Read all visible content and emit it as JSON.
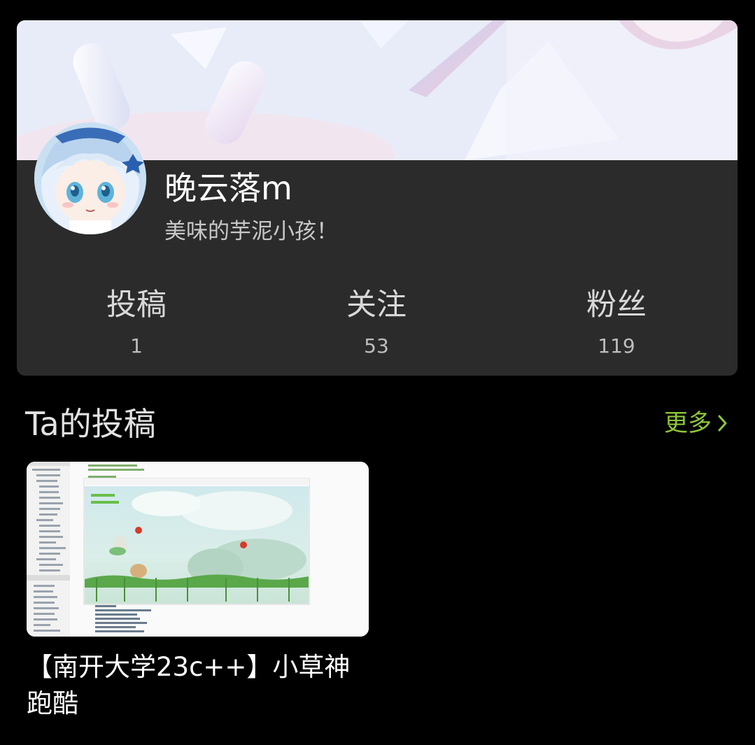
{
  "profile": {
    "username": "晚云落m",
    "bio": "美味的芋泥小孩！",
    "stats": [
      {
        "label": "投稿",
        "value": "1"
      },
      {
        "label": "关注",
        "value": "53"
      },
      {
        "label": "粉丝",
        "value": "119"
      }
    ]
  },
  "section": {
    "title": "Ta的投稿",
    "more_label": "更多"
  },
  "videos": [
    {
      "title": "【南开大学23c++】小草神跑酷"
    }
  ],
  "colors": {
    "background": "#000000",
    "card": "#2b2b2b",
    "accent": "#8fc63a"
  },
  "icons": {
    "more": "chevron-right-icon"
  }
}
